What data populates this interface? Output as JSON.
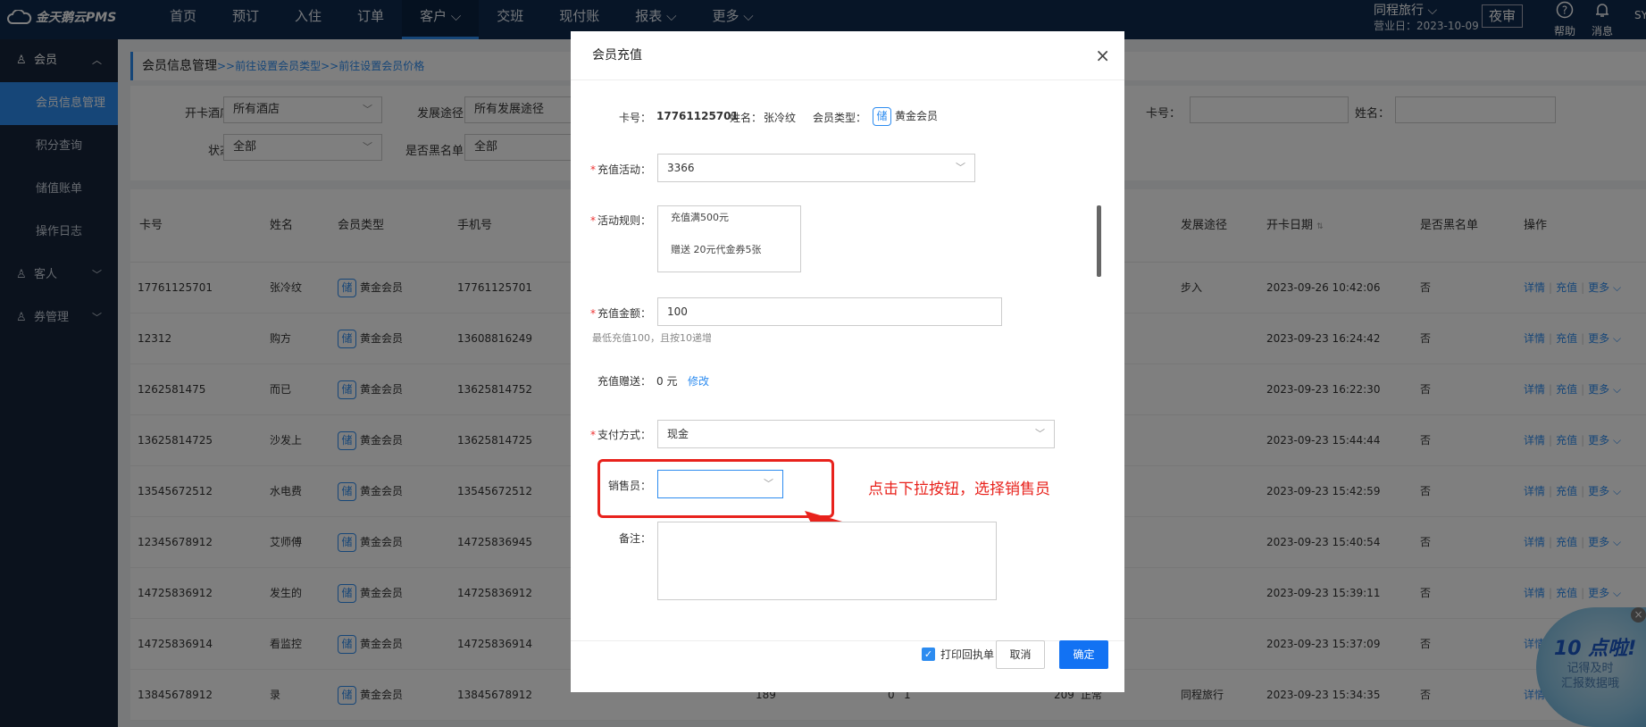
{
  "app": {
    "title": "金天鹅云PMS"
  },
  "nav": [
    "首页",
    "预订",
    "入住",
    "订单",
    "客户",
    "交班",
    "现付账",
    "报表",
    "更多"
  ],
  "nav_dropdown": [
    "客户",
    "报表",
    "更多"
  ],
  "header": {
    "hotel": "同程旅行",
    "biz_date": "营业日：2023-10-09",
    "night_audit": "夜审",
    "help": "帮助",
    "message": "消息",
    "user": "SY"
  },
  "sidebar": {
    "member": "会员",
    "member_items": [
      "会员信息管理",
      "积分查询",
      "储值账单",
      "操作日志"
    ],
    "guest": "客人",
    "coupon": "券管理"
  },
  "breadcrumb": {
    "title": "会员信息管理",
    "link1": ">>前往设置会员类型",
    "link2": ">>前往设置会员价格"
  },
  "filters": {
    "hotel_label": "开卡酒店：",
    "hotel_value": "所有酒店",
    "source_label": "发展途径：",
    "source_value": "所有发展途径",
    "card_label": "卡号：",
    "name_label": "姓名：",
    "status_label": "状态：",
    "status_value": "全部",
    "blacklist_label": "是否黑名单：",
    "blacklist_value": "全部"
  },
  "table": {
    "headers": {
      "card": "卡号",
      "name": "姓名",
      "type": "会员类型",
      "phone": "手机号",
      "source": "发展途径",
      "open_date": "开卡日期",
      "blacklist": "是否黑名单",
      "ops": "操作"
    },
    "badge": "储",
    "op_detail": "详情",
    "op_recharge": "充值",
    "op_more": "更多",
    "rows": [
      {
        "card": "17761125701",
        "name": "张冷纹",
        "type": "黄金会员",
        "phone": "17761125701",
        "source": "步入",
        "date": "2023-09-26 10:42:06",
        "black": "否"
      },
      {
        "card": "12312",
        "name": "购方",
        "type": "黄金会员",
        "phone": "13608816249",
        "source": "",
        "date": "2023-09-23 16:24:42",
        "black": "否"
      },
      {
        "card": "1262581475",
        "name": "而已",
        "type": "黄金会员",
        "phone": "13625814752",
        "source": "",
        "date": "2023-09-23 16:22:30",
        "black": "否"
      },
      {
        "card": "13625814725",
        "name": "沙发上",
        "type": "黄金会员",
        "phone": "13625814725",
        "source": "",
        "date": "2023-09-23 15:44:44",
        "black": "否"
      },
      {
        "card": "13545672512",
        "name": "水电费",
        "type": "黄金会员",
        "phone": "13545672512",
        "source": "",
        "date": "2023-09-23 15:42:59",
        "black": "否"
      },
      {
        "card": "12345678912",
        "name": "艾师傅",
        "type": "黄金会员",
        "phone": "14725836945",
        "source": "",
        "date": "2023-09-23 15:40:54",
        "black": "否"
      },
      {
        "card": "14725836912",
        "name": "发生的",
        "type": "黄金会员",
        "phone": "14725836912",
        "source": "",
        "date": "2023-09-23 15:39:11",
        "black": "否"
      },
      {
        "card": "14725836914",
        "name": "看监控",
        "type": "黄金会员",
        "phone": "14725836914",
        "source": "",
        "date": "2023-09-23 15:37:09",
        "black": "否"
      },
      {
        "card": "13845678912",
        "name": "录",
        "type": "黄金会员",
        "phone": "13845678912",
        "source": "同程旅行",
        "date": "2023-09-23 15:34:35",
        "black": "否",
        "extra1": "189",
        "extra2": "0",
        "extra3": "1",
        "extra4": "209",
        "extra5": "正常"
      }
    ]
  },
  "modal": {
    "title": "会员充值",
    "card_label": "卡号：",
    "card_value": "17761125701",
    "name_label": "姓名：",
    "name_value": "张冷纹",
    "type_label": "会员类型：",
    "type_badge": "储",
    "type_value": "黄金会员",
    "activity_label": "充值活动：",
    "activity_value": "3366",
    "rules_label": "活动规则：",
    "rule1": "充值满500元",
    "rule2": "赠送 20元代金券5张",
    "amount_label": "充值金额：",
    "amount_value": "100",
    "amount_hint": "最低充值100，且按10递增",
    "gift_label": "充值赠送：",
    "gift_value": "0 元",
    "gift_edit": "修改",
    "pay_label": "支付方式：",
    "pay_value": "现金",
    "seller_label": "销售员：",
    "seller_value": "",
    "remark_label": "备注：",
    "print_label": "打印回执单",
    "cancel": "取消",
    "ok": "确定",
    "annotation": "点击下拉按钮，选择销售员"
  },
  "promo": {
    "big": "10 点啦!",
    "line1": "记得及时",
    "line2": "汇报数据哦"
  },
  "colors": {
    "primary": "#2d8cf0",
    "topbar": "#0f2a4e",
    "sidebar": "#16243a",
    "annotation": "#e8221c"
  }
}
